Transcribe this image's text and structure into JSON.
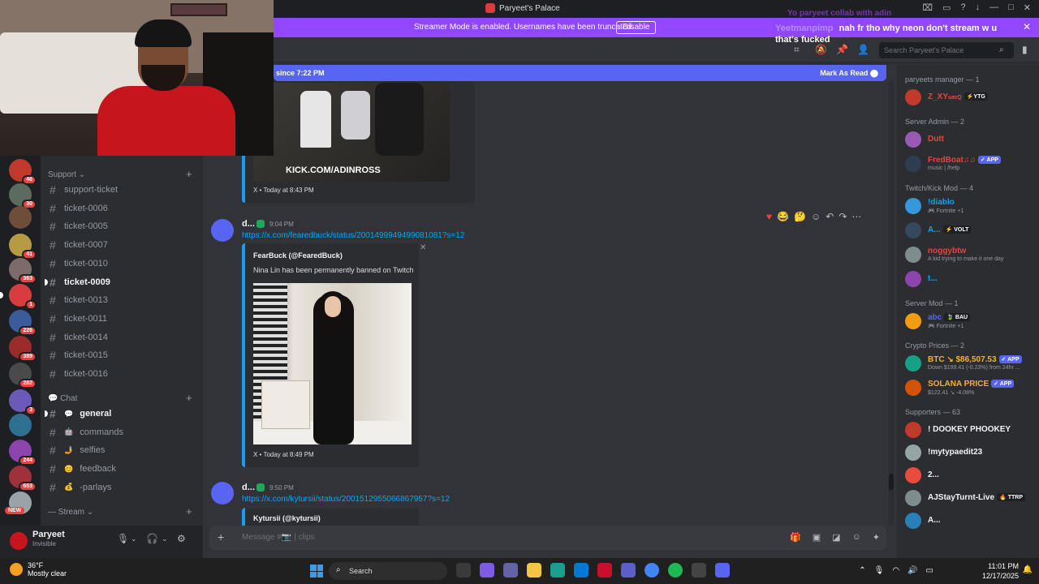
{
  "window": {
    "title": "Paryeet's Palace",
    "controls": [
      "—",
      "□",
      "✕"
    ]
  },
  "stream_overlay": {
    "faded_text": "Yo paryeet collab with adin",
    "user": "Yeetmanpimp",
    "message": "nah fr tho why neon don't stream w u that's fucked"
  },
  "banner": {
    "text": "Streamer Mode is enabled. Usernames have been truncated.",
    "disable_label": "Disable",
    "close": "✕"
  },
  "header": {
    "search_placeholder": "Search Paryeet's Palace"
  },
  "new_messages": {
    "text": "since 7:22 PM",
    "mark_label": "Mark As Read"
  },
  "servers": {
    "badges": [
      "46",
      "30",
      "",
      "41",
      "363",
      "1",
      "226",
      "389",
      "282",
      "3",
      "244",
      "653",
      ""
    ],
    "new_label": "NEW"
  },
  "channels": {
    "support_category": "Support",
    "support": [
      {
        "name": "support-ticket",
        "bold": false
      },
      {
        "name": "ticket-0006",
        "bold": false
      },
      {
        "name": "ticket-0005",
        "bold": false
      },
      {
        "name": "ticket-0007",
        "bold": false
      },
      {
        "name": "ticket-0010",
        "bold": false
      },
      {
        "name": "ticket-0009",
        "bold": true
      },
      {
        "name": "ticket-0013",
        "bold": false
      },
      {
        "name": "ticket-0011",
        "bold": false
      },
      {
        "name": "ticket-0014",
        "bold": false
      },
      {
        "name": "ticket-0015",
        "bold": false
      },
      {
        "name": "ticket-0016",
        "bold": false
      }
    ],
    "chat_category": "Chat",
    "chat": [
      {
        "emoji": "💬",
        "name": "general",
        "bold": true
      },
      {
        "emoji": "🤖",
        "name": "commands",
        "bold": false
      },
      {
        "emoji": "🤳",
        "name": "selfies",
        "bold": false
      },
      {
        "emoji": "😊",
        "name": "feedback",
        "bold": false
      },
      {
        "emoji": "💰",
        "name": "-parlays",
        "bold": false
      }
    ],
    "stream_category": "Stream"
  },
  "user_panel": {
    "name": "Paryeet",
    "status": "Invisible"
  },
  "messages": {
    "embed1": {
      "watermark": "KICK.COM/ADINROSS",
      "footer": "X • Today at 8:43 PM"
    },
    "msg2": {
      "user": "d...",
      "time": "9:04 PM",
      "link": "https://x.com/fearedbuck/status/2001499949499081081?s=12",
      "author": "FearBuck (@FearedBuck)",
      "desc": "Nina Lin has been permanently banned on Twitch",
      "footer": "X • Today at 8:49 PM"
    },
    "msg3": {
      "user": "d...",
      "time": "9:50 PM",
      "link": "https://x.com/kytursii/status/2001512955066867957?s=12",
      "author": "Kytursii (@kytursii)"
    }
  },
  "composer": {
    "placeholder": "Message #📷 | clips"
  },
  "members": {
    "groups": [
      {
        "title": "paryeets manager — 1",
        "members": [
          {
            "name": "Z_XY",
            "suffix": "ɢʙɪQ",
            "tag": "⚡YTG",
            "color": "#f23f42",
            "sub": ""
          }
        ]
      },
      {
        "title": "Server Admin — 2",
        "members": [
          {
            "name": "Dutt",
            "suffix": "",
            "tag": "",
            "color": "#f23f42",
            "sub": ""
          },
          {
            "name": "FredBoat♫♫",
            "suffix": "",
            "tag": "✓ APP",
            "color": "#f23f42",
            "sub": "music | /help"
          }
        ]
      },
      {
        "title": "Twitch/Kick Mod — 4",
        "members": [
          {
            "name": "!diablo",
            "suffix": "",
            "tag": "",
            "color": "#00a8fc",
            "sub": "🎮 Fortnite +1"
          },
          {
            "name": "A...",
            "suffix": "",
            "tag": "⚡ VOLT",
            "color": "#00a8fc",
            "sub": ""
          },
          {
            "name": "noggybtw",
            "suffix": "",
            "tag": "",
            "color": "#f23f42",
            "sub": "A kid trying to make it one day"
          },
          {
            "name": "t...",
            "suffix": "",
            "tag": "",
            "color": "#00a8fc",
            "sub": ""
          }
        ]
      },
      {
        "title": "Server Mod — 1",
        "members": [
          {
            "name": "abc",
            "suffix": "",
            "tag": "🍃 BAU",
            "color": "#5865f2",
            "sub": "🎮 Fortnite +1"
          }
        ]
      },
      {
        "title": "Crypto Prices — 2",
        "members": [
          {
            "name": "BTC ↘ $86,507.53",
            "suffix": "",
            "tag": "✓ APP",
            "color": "#f0b232",
            "sub": "Down $199.41 (-0.23%) from 24hr ..."
          },
          {
            "name": "SOLANA PRICE",
            "suffix": "",
            "tag": "✓ APP",
            "color": "#f0b232",
            "sub": "$122.41 ↘ -4.08%"
          }
        ]
      },
      {
        "title": "Supporters — 63",
        "members": [
          {
            "name": "! DOOKEY PHOOKEY",
            "suffix": "",
            "tag": "",
            "color": "#f2f3f5",
            "sub": ""
          },
          {
            "name": "!mytypaedit23",
            "suffix": "",
            "tag": "",
            "color": "#f2f3f5",
            "sub": ""
          },
          {
            "name": "2...",
            "suffix": "",
            "tag": "",
            "color": "#f2f3f5",
            "sub": ""
          },
          {
            "name": "AJStayTurnt-Live",
            "suffix": "",
            "tag": "🔥 TTRP",
            "color": "#f2f3f5",
            "sub": ""
          },
          {
            "name": "A...",
            "suffix": "",
            "tag": "",
            "color": "#f2f3f5",
            "sub": ""
          }
        ]
      }
    ]
  },
  "taskbar": {
    "temp": "36°F",
    "weather": "Mostly clear",
    "weather_badge": "2",
    "search": "Search",
    "time": "11:01 PM",
    "date": "12/17/2025"
  }
}
